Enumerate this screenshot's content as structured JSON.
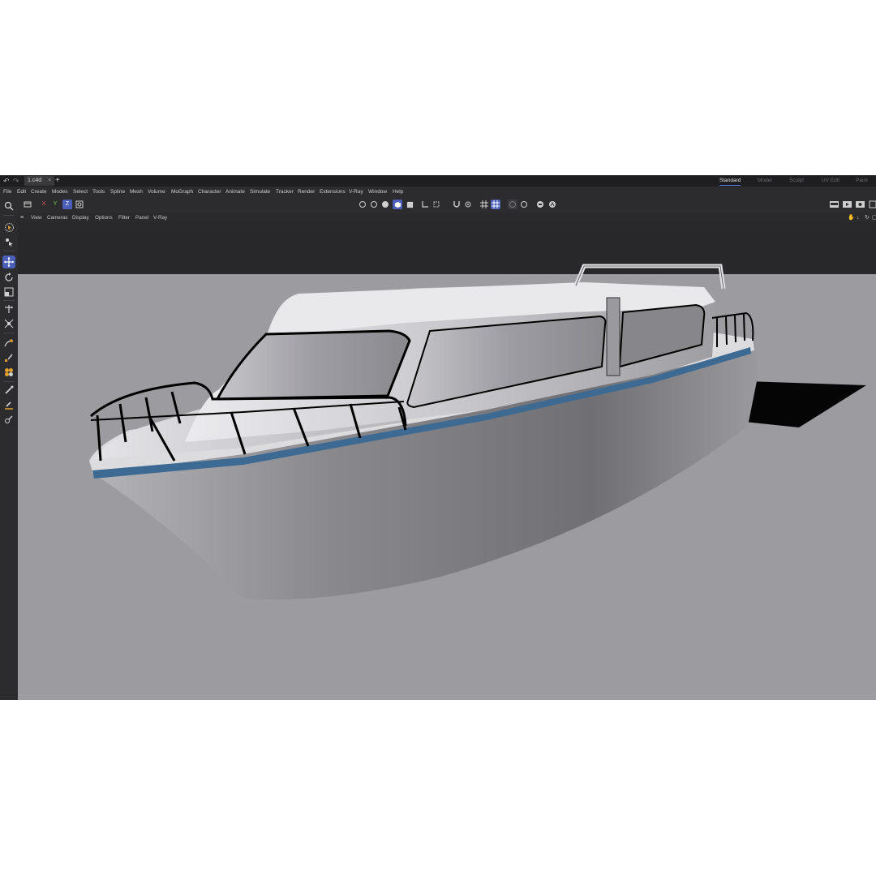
{
  "titlebar": {
    "document_tab": "1.c4d",
    "close_glyph": "×",
    "new_tab_glyph": "+",
    "undo_icon": "undo-icon",
    "redo_icon": "redo-icon",
    "layouts": [
      {
        "label": "Standard",
        "active": true
      },
      {
        "label": "Model",
        "active": false
      },
      {
        "label": "Sculpt",
        "active": false
      },
      {
        "label": "UV Edit",
        "active": false
      },
      {
        "label": "Paint",
        "active": false
      }
    ]
  },
  "menubar": {
    "items": [
      "File",
      "Edit",
      "Create",
      "Modes",
      "Select",
      "Tools",
      "Spline",
      "Mesh",
      "Volume",
      "MoGraph",
      "Character",
      "Animate",
      "Simulate",
      "Tracker",
      "Render",
      "Extensions",
      "V-Ray",
      "Window",
      "Help"
    ]
  },
  "toolbar": {
    "axis_x": "X",
    "axis_y": "Y",
    "axis_z": "Z",
    "accent_color": "#4b5fb8",
    "axis_x_color": "#e05555",
    "axis_y_color": "#7ccf5a"
  },
  "viewport_menu": {
    "items": [
      "View",
      "Cameras",
      "Display",
      "Options",
      "Filter",
      "Panel",
      "V-Ray"
    ]
  },
  "viewport": {
    "background_color": "#9c9ba0",
    "hull_stripe_color": "#3d6a92"
  }
}
